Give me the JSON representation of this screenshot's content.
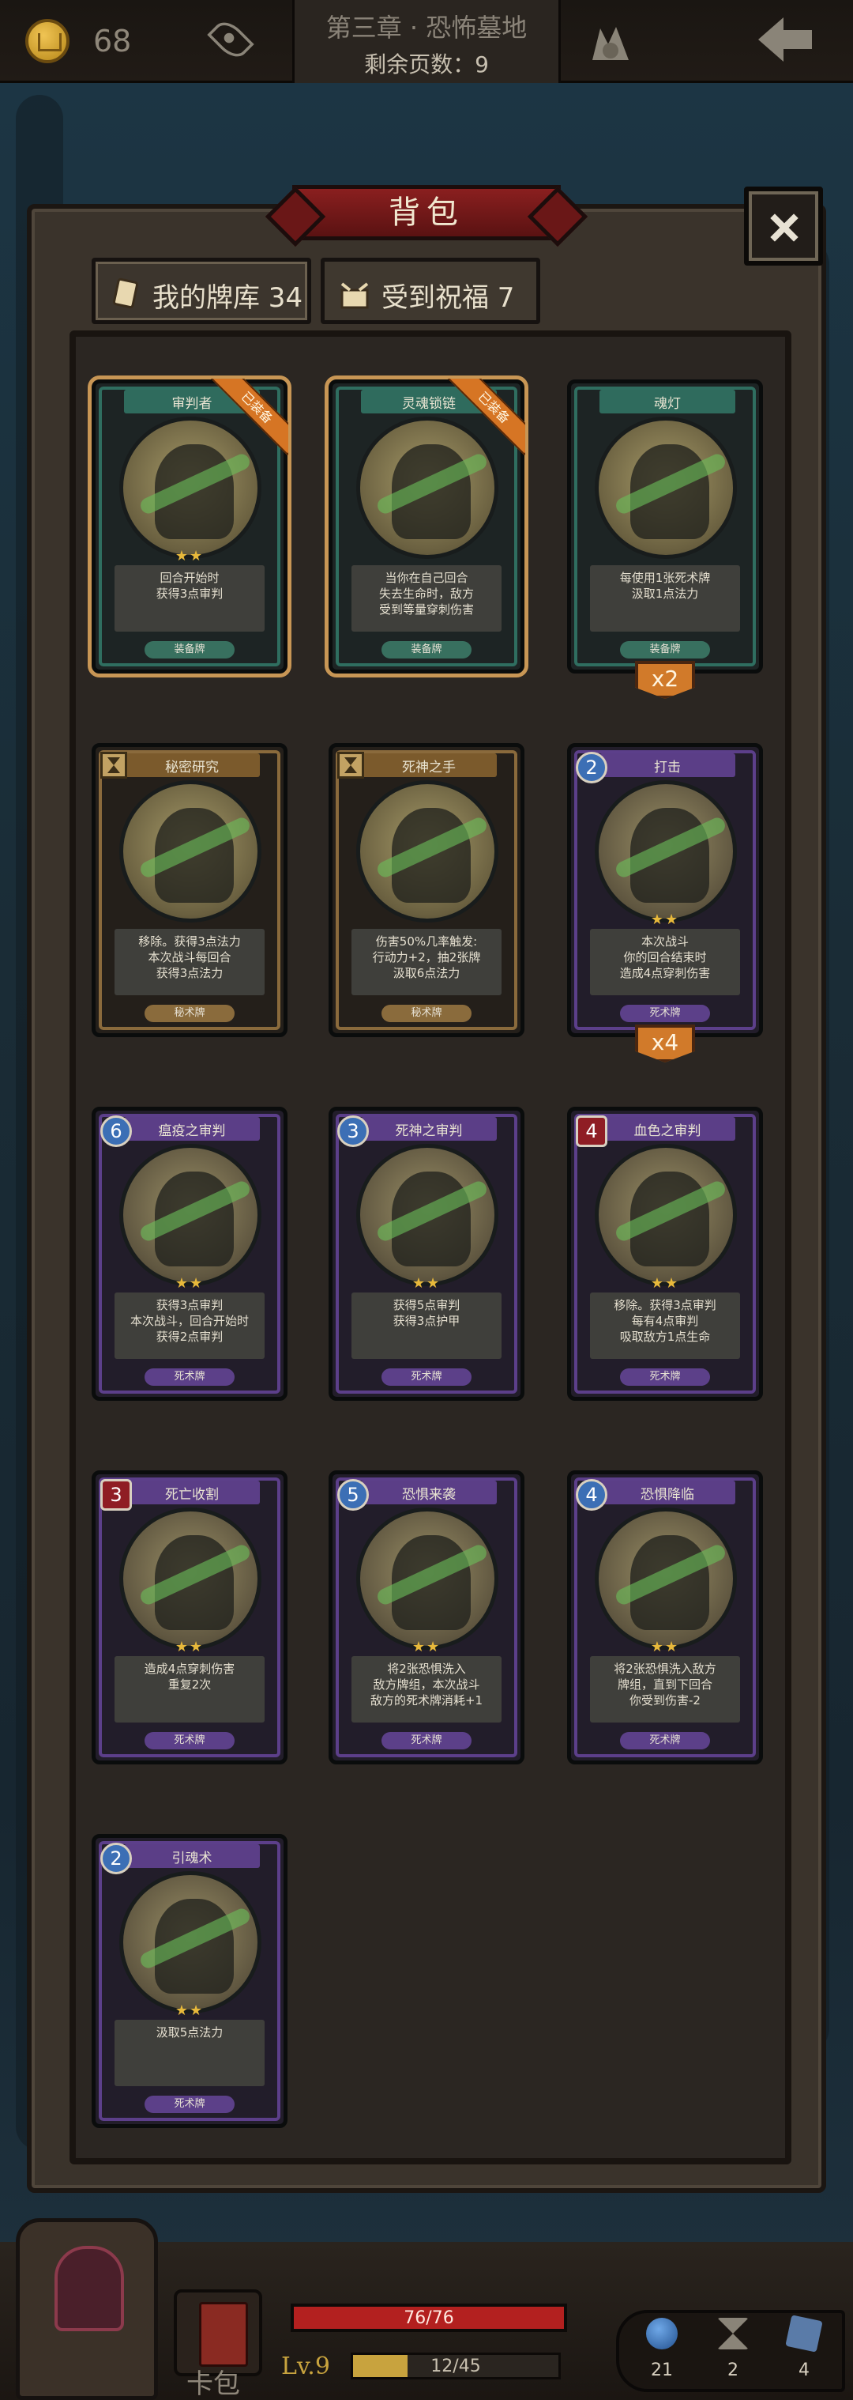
{
  "topbar": {
    "coins": "68",
    "chapter_title": "第三章 · 恐怖墓地",
    "pages_left": "剩余页数：9"
  },
  "backpack": {
    "title": "背包",
    "tabs": [
      {
        "label": "我的牌库 34"
      },
      {
        "label": "受到祝福 7"
      }
    ]
  },
  "cards": [
    {
      "name": "审判者",
      "cost": "",
      "cost_type": "none",
      "theme": "teal",
      "equipped_label": "已装备",
      "stars": "★★",
      "desc": "回合开始时\n获得3点审判",
      "type": "装备牌",
      "multiplier": ""
    },
    {
      "name": "灵魂锁链",
      "cost": "",
      "cost_type": "none",
      "theme": "teal",
      "equipped_label": "已装备",
      "stars": "",
      "desc": "当你在自己回合\n失去生命时，敌方\n受到等量穿刺伤害",
      "type": "装备牌",
      "multiplier": ""
    },
    {
      "name": "魂灯",
      "cost": "",
      "cost_type": "none",
      "theme": "teal",
      "equipped_label": "",
      "stars": "",
      "desc": "每使用1张死术牌\n汲取1点法力",
      "type": "装备牌",
      "multiplier": "x2"
    },
    {
      "name": "秘密研究",
      "cost": "",
      "cost_type": "hourglass",
      "theme": "brown",
      "equipped_label": "",
      "stars": "",
      "desc": "移除。获得3点法力\n本次战斗每回合\n获得3点法力",
      "type": "秘术牌",
      "multiplier": ""
    },
    {
      "name": "死神之手",
      "cost": "",
      "cost_type": "hourglass",
      "theme": "brown",
      "equipped_label": "",
      "stars": "",
      "desc": "伤害50%几率触发:\n行动力+2，抽2张牌\n汲取6点法力",
      "type": "秘术牌",
      "multiplier": ""
    },
    {
      "name": "打击",
      "cost": "2",
      "cost_type": "blue",
      "theme": "purple",
      "equipped_label": "",
      "stars": "★★",
      "desc": "本次战斗\n你的回合结束时\n造成4点穿刺伤害",
      "type": "死术牌",
      "multiplier": "x4"
    },
    {
      "name": "瘟疫之审判",
      "cost": "6",
      "cost_type": "blue",
      "theme": "purple",
      "equipped_label": "",
      "stars": "★★",
      "desc": "获得3点审判\n本次战斗，回合开始时\n获得2点审判",
      "type": "死术牌",
      "multiplier": ""
    },
    {
      "name": "死神之审判",
      "cost": "3",
      "cost_type": "blue",
      "theme": "purple",
      "equipped_label": "",
      "stars": "★★",
      "desc": "获得5点审判\n获得3点护甲",
      "type": "死术牌",
      "multiplier": ""
    },
    {
      "name": "血色之审判",
      "cost": "4",
      "cost_type": "red",
      "theme": "purple",
      "equipped_label": "",
      "stars": "★★",
      "desc": "移除。获得3点审判\n每有4点审判\n吸取敌方1点生命",
      "type": "死术牌",
      "multiplier": ""
    },
    {
      "name": "死亡收割",
      "cost": "3",
      "cost_type": "red",
      "theme": "purple",
      "equipped_label": "",
      "stars": "★★",
      "desc": "造成4点穿刺伤害\n重复2次",
      "type": "死术牌",
      "multiplier": ""
    },
    {
      "name": "恐惧来袭",
      "cost": "5",
      "cost_type": "blue",
      "theme": "purple",
      "equipped_label": "",
      "stars": "★★",
      "desc": "将2张恐惧洗入\n敌方牌组，本次战斗\n敌方的死术牌消耗+1",
      "type": "死术牌",
      "multiplier": ""
    },
    {
      "name": "恐惧降临",
      "cost": "4",
      "cost_type": "blue",
      "theme": "purple",
      "equipped_label": "",
      "stars": "★★",
      "desc": "将2张恐惧洗入敌方\n牌组，直到下回合\n你受到伤害-2",
      "type": "死术牌",
      "multiplier": ""
    },
    {
      "name": "引魂术",
      "cost": "2",
      "cost_type": "blue",
      "theme": "purple",
      "equipped_label": "",
      "stars": "★★",
      "desc": "汲取5点法力",
      "type": "死术牌",
      "multiplier": ""
    }
  ],
  "bottombar": {
    "deck_label": "卡包",
    "hp": "76/76",
    "hp_fraction": 1.0,
    "level": "Lv.9",
    "xp": "12/45",
    "xp_fraction": 0.267,
    "stats": [
      "21",
      "2",
      "4"
    ]
  },
  "colors": {
    "accent_red": "#8a1f1f",
    "gold": "#e8b93b",
    "teal": "#2f6b5d",
    "purple": "#5b3e87"
  }
}
